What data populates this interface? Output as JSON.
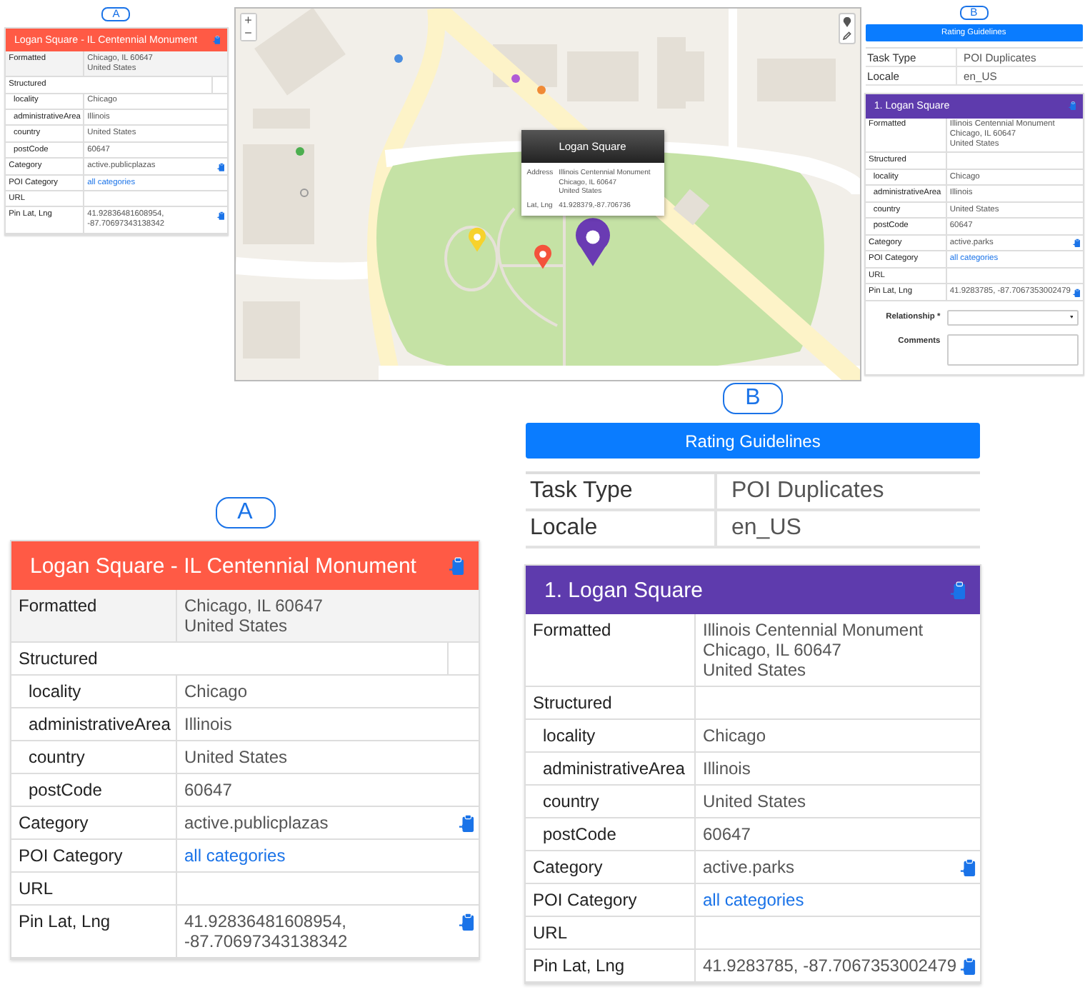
{
  "top": {
    "card_a": {
      "badge": "A",
      "header": {
        "title": "Logan Square - IL Centennial Monument",
        "color": "#ff5a45",
        "copy_icon": true
      },
      "rows": [
        {
          "kind": "field",
          "label": "Formatted",
          "value": "Chicago, IL 60647\nUnited States",
          "shaded": true,
          "copy_icon": false
        },
        {
          "kind": "section",
          "label": "Structured",
          "shaded": false
        },
        {
          "kind": "sub",
          "label": "locality",
          "value": "Chicago",
          "shaded": false,
          "copy_icon": false
        },
        {
          "kind": "sub",
          "label": "administrativeArea",
          "value": "Illinois",
          "shaded": false,
          "copy_icon": false
        },
        {
          "kind": "sub",
          "label": "country",
          "value": "United States",
          "shaded": false,
          "copy_icon": false
        },
        {
          "kind": "sub",
          "label": "postCode",
          "value": "60647",
          "shaded": false,
          "copy_icon": false
        },
        {
          "kind": "field",
          "label": "Category",
          "value": "active.publicplazas",
          "shaded": false,
          "copy_icon": true
        },
        {
          "kind": "link",
          "label": "POI Category",
          "value": "all categories",
          "shaded": false,
          "copy_icon": false
        },
        {
          "kind": "field",
          "label": "URL",
          "shaded": false,
          "copy_icon": false
        },
        {
          "kind": "field",
          "label": "Pin Lat, Lng",
          "value": "41.92836481608954,\n-87.70697343138342",
          "shaded": false,
          "copy_icon": true
        }
      ]
    },
    "map": {
      "zoom_in": "+",
      "zoom_out": "−",
      "pins": [
        {
          "kind": "small",
          "color": "#f7d22d"
        },
        {
          "kind": "small",
          "color": "#f4533c"
        },
        {
          "kind": "large",
          "color": "#6a3bb3"
        }
      ],
      "popup": {
        "title": "Logan Square",
        "rows": [
          {
            "label": "Address",
            "value": "Illinois Centennial Monument\nChicago, IL 60647\nUnited States"
          },
          {
            "label": "Lat, Lng",
            "value": "41.928379,-87.706736"
          }
        ]
      }
    },
    "card_b": {
      "badge": "B",
      "guidelines_button": "Rating Guidelines",
      "meta": [
        {
          "label": "Task Type",
          "value": "POI Duplicates"
        },
        {
          "label": "Locale",
          "value": "en_US"
        }
      ],
      "header": {
        "title": "1. Logan Square",
        "color": "#5e3bad",
        "copy_icon": true
      },
      "rows": [
        {
          "kind": "field",
          "label": "Formatted",
          "value": "Illinois Centennial Monument\nChicago, IL 60647\nUnited States",
          "shaded": false,
          "copy_icon": false
        },
        {
          "kind": "section",
          "label": "Structured",
          "shaded": false
        },
        {
          "kind": "sub",
          "label": "locality",
          "value": "Chicago",
          "shaded": false,
          "copy_icon": false
        },
        {
          "kind": "sub",
          "label": "administrativeArea",
          "value": "Illinois",
          "shaded": false,
          "copy_icon": false
        },
        {
          "kind": "sub",
          "label": "country",
          "value": "United States",
          "shaded": false,
          "copy_icon": false
        },
        {
          "kind": "sub",
          "label": "postCode",
          "value": "60647",
          "shaded": false,
          "copy_icon": false
        },
        {
          "kind": "field",
          "label": "Category",
          "value": "active.parks",
          "shaded": false,
          "copy_icon": true
        },
        {
          "kind": "link",
          "label": "POI Category",
          "value": "all categories",
          "shaded": false,
          "copy_icon": false
        },
        {
          "kind": "field",
          "label": "URL",
          "shaded": false,
          "copy_icon": false
        },
        {
          "kind": "field",
          "label": "Pin Lat, Lng",
          "value": "41.9283785, -87.7067353002479",
          "shaded": false,
          "copy_icon": true
        }
      ],
      "form": {
        "relationship_label": "Relationship *",
        "comments_label": "Comments"
      }
    }
  },
  "bottom": {
    "card_a": {
      "badge": "A",
      "header": {
        "title": "Logan Square - IL Centennial Monument",
        "color": "#ff5a45",
        "copy_icon": true
      },
      "rows": [
        {
          "kind": "field",
          "label": "Formatted",
          "value": "Chicago, IL 60647\nUnited States",
          "shaded": true,
          "copy_icon": false
        },
        {
          "kind": "section",
          "label": "Structured",
          "shaded": false
        },
        {
          "kind": "sub",
          "label": "locality",
          "value": "Chicago",
          "shaded": false,
          "copy_icon": false
        },
        {
          "kind": "sub",
          "label": "administrativeArea",
          "value": "Illinois",
          "shaded": false,
          "copy_icon": false
        },
        {
          "kind": "sub",
          "label": "country",
          "value": "United States",
          "shaded": false,
          "copy_icon": false
        },
        {
          "kind": "sub",
          "label": "postCode",
          "value": "60647",
          "shaded": false,
          "copy_icon": false
        },
        {
          "kind": "field",
          "label": "Category",
          "value": "active.publicplazas",
          "shaded": false,
          "copy_icon": true
        },
        {
          "kind": "link",
          "label": "POI Category",
          "value": "all categories",
          "shaded": false,
          "copy_icon": false
        },
        {
          "kind": "field",
          "label": "URL",
          "shaded": false,
          "copy_icon": false
        },
        {
          "kind": "field",
          "label": "Pin Lat, Lng",
          "value": "41.92836481608954,\n-87.70697343138342",
          "shaded": false,
          "copy_icon": true
        }
      ]
    },
    "card_b": {
      "badge": "B",
      "guidelines_button": "Rating Guidelines",
      "meta": [
        {
          "label": "Task Type",
          "value": "POI Duplicates"
        },
        {
          "label": "Locale",
          "value": "en_US"
        }
      ],
      "header": {
        "title": "1. Logan Square",
        "color": "#5e3bad",
        "copy_icon": true
      },
      "rows": [
        {
          "kind": "field",
          "label": "Formatted",
          "value": "Illinois Centennial Monument\nChicago, IL 60647\nUnited States",
          "shaded": false,
          "copy_icon": false
        },
        {
          "kind": "section",
          "label": "Structured",
          "shaded": false
        },
        {
          "kind": "sub",
          "label": "locality",
          "value": "Chicago",
          "shaded": false,
          "copy_icon": false
        },
        {
          "kind": "sub",
          "label": "administrativeArea",
          "value": "Illinois",
          "shaded": false,
          "copy_icon": false
        },
        {
          "kind": "sub",
          "label": "country",
          "value": "United States",
          "shaded": false,
          "copy_icon": false
        },
        {
          "kind": "sub",
          "label": "postCode",
          "value": "60647",
          "shaded": false,
          "copy_icon": false
        },
        {
          "kind": "field",
          "label": "Category",
          "value": "active.parks",
          "shaded": false,
          "copy_icon": true
        },
        {
          "kind": "link",
          "label": "POI Category",
          "value": "all categories",
          "shaded": false,
          "copy_icon": false
        },
        {
          "kind": "field",
          "label": "URL",
          "shaded": false,
          "copy_icon": false
        },
        {
          "kind": "field",
          "label": "Pin Lat, Lng",
          "value": "41.9283785, -87.7067353002479",
          "shaded": false,
          "copy_icon": true
        }
      ]
    }
  }
}
